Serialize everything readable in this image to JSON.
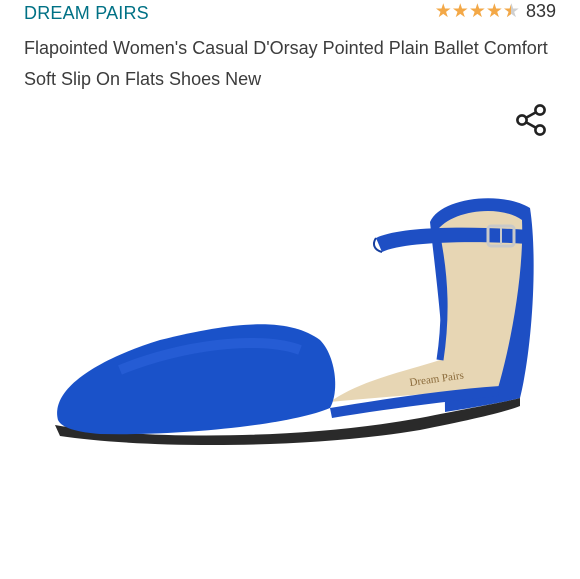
{
  "product": {
    "brand": "DREAM PAIRS",
    "rating": {
      "stars": 4.5,
      "max_stars": 5,
      "count": "839"
    },
    "title": "Flapointed Women's Casual D'Orsay Pointed Plain Ballet Comfort Soft Slip On Flats Shoes New",
    "share_icon": "share-icon",
    "image": {
      "description_icon": "shoe-image",
      "color": "#1a52c9",
      "insole_color": "#e7d6b4"
    }
  }
}
